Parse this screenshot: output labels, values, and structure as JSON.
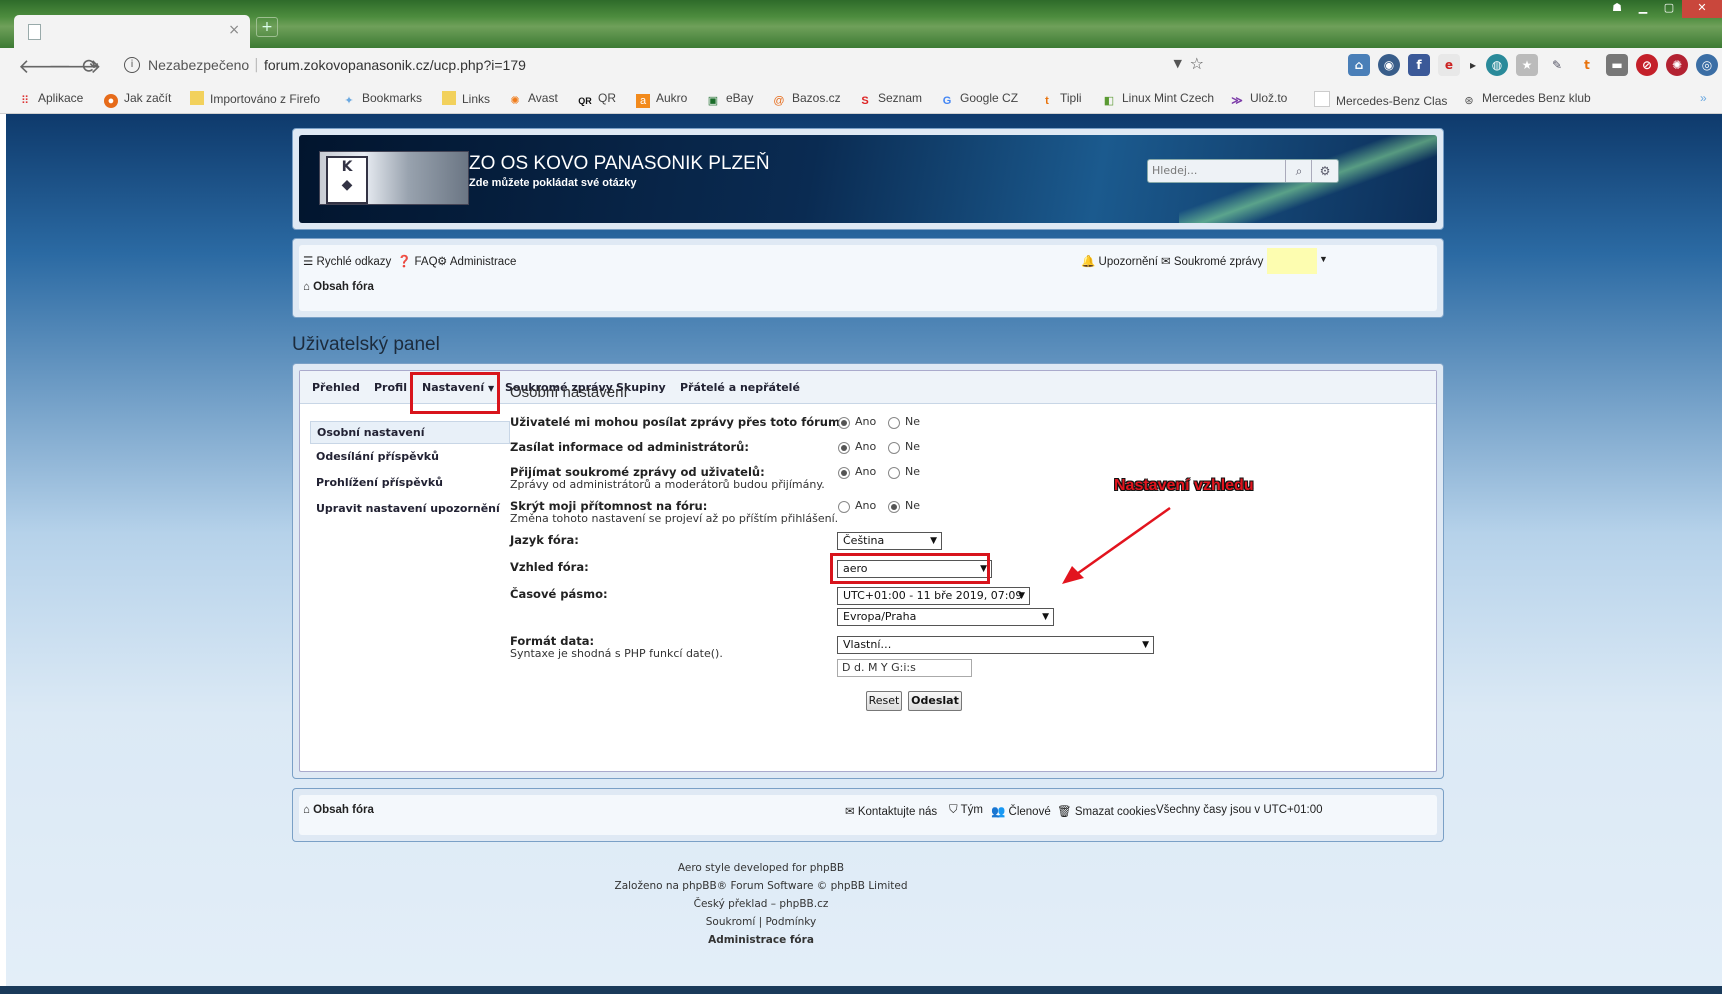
{
  "browser": {
    "address": {
      "security": "Nezabezpečeno",
      "url": "forum.zokovopanasonik.cz/ucp.php?i=179"
    },
    "bookmarks": [
      "Aplikace",
      "Jak začít",
      "Importováno z Firefo",
      "Bookmarks",
      "Links",
      "Avast",
      "QR",
      "Aukro",
      "eBay",
      "Bazos.cz",
      "Seznam",
      "Google CZ",
      "Tipli",
      "Linux Mint Czech",
      "Ulož.to",
      "Mercedes-Benz Clas",
      "Mercedes Benz klub"
    ]
  },
  "site": {
    "title": "ZO OS KOVO PANASONIK PLZEŇ",
    "description": "Zde můžete pokládat své otázky",
    "search_placeholder": "Hledej..."
  },
  "nav": {
    "quick_links": "Rychlé odkazy",
    "faq": "FAQ",
    "admin": "Administrace",
    "notifications": "Upozornění",
    "private_messages": "Soukromé zprávy",
    "board_index": "Obsah fóra"
  },
  "ucp": {
    "page_title": "Uživatelský panel",
    "tabs": [
      "Přehled",
      "Profil",
      "Nastavení",
      "Soukromé zprávy",
      "Skupiny",
      "Přátelé a nepřátelé"
    ],
    "sidebar": [
      "Osobní nastavení",
      "Odesílání příspěvků",
      "Prohlížení příspěvků",
      "Upravit nastavení upozornění"
    ],
    "panel_title": "Osobní nastavení",
    "yes": "Ano",
    "no": "Ne",
    "fields": {
      "allow_pm": "Uživatelé mi mohou posílat zprávy přes toto fórum:",
      "admin_mail": "Zasílat informace od administrátorů:",
      "receive_pm": "Přijímat soukromé zprávy od uživatelů:",
      "receive_pm_note": "Zprávy od administrátorů a moderátorů budou přijímány.",
      "hide_online": "Skrýt moji přítomnost na fóru:",
      "hide_online_note": "Změna tohoto nastavení se projeví až po příštím přihlášení.",
      "language": "Jazyk fóra:",
      "style": "Vzhled fóra:",
      "timezone": "Časové pásmo:",
      "dateformat": "Formát data:",
      "dateformat_note": "Syntaxe je shodná s PHP funkcí date()."
    },
    "values": {
      "language": "Čeština",
      "style": "aero",
      "timezone": "UTC+01:00 - 11 bře 2019, 07:09",
      "timezone_region": "Evropa/Praha",
      "dateformat_select": "Vlastní…",
      "dateformat_custom": "D d. M Y G:i:s"
    },
    "buttons": {
      "reset": "Reset",
      "submit": "Odeslat"
    }
  },
  "annotation": "Nastavení vzhledu",
  "footer": {
    "board_index": "Obsah fóra",
    "contact": "Kontaktujte nás",
    "team": "Tým",
    "members": "Členové",
    "delete_cookies": "Smazat cookies",
    "timezone_note": "Všechny časy jsou v UTC+01:00",
    "credits": [
      "Aero style developed for phpBB",
      "Založeno na phpBB® Forum Software © phpBB Limited",
      "Český překlad – phpBB.cz",
      "Soukromí | Podmínky",
      "Administrace fóra"
    ]
  }
}
